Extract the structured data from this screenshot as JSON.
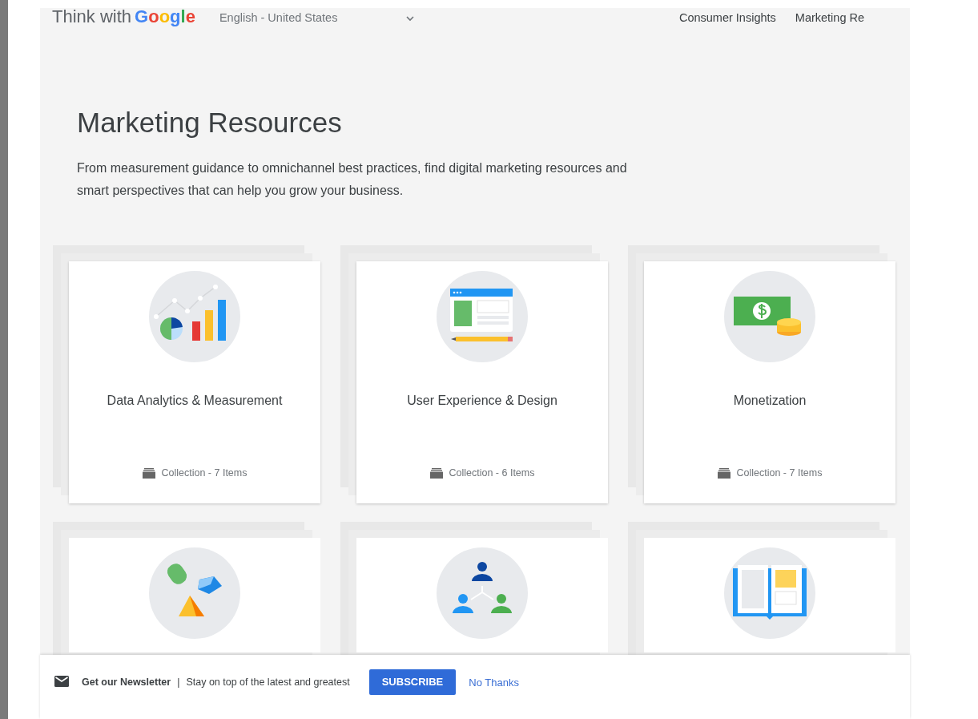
{
  "header": {
    "logo_prefix": "Think with",
    "logo_brand": "Google",
    "language": "English - United States",
    "nav": [
      {
        "label": "Consumer Insights"
      },
      {
        "label": "Marketing Re"
      }
    ]
  },
  "hero": {
    "title": "Marketing Resources",
    "description": "From measurement guidance to omnichannel best practices, find digital marketing resources and smart perspectives that can help you grow your business."
  },
  "cards": [
    {
      "kind": "collection",
      "title": "Data Analytics & Measurement",
      "meta": "Collection - 7 Items"
    },
    {
      "kind": "collection",
      "title": "User Experience & Design",
      "meta": "Collection - 6 Items"
    },
    {
      "kind": "collection",
      "title": "Monetization",
      "meta": "Collection - 7 Items"
    },
    {
      "kind": "clipped"
    },
    {
      "kind": "clipped"
    },
    {
      "kind": "clipped"
    }
  ],
  "newsletter": {
    "title": "Get our Newsletter",
    "separator": "|",
    "text": "Stay on top of the latest and greatest",
    "subscribe": "SUBSCRIBE",
    "dismiss": "No Thanks"
  }
}
